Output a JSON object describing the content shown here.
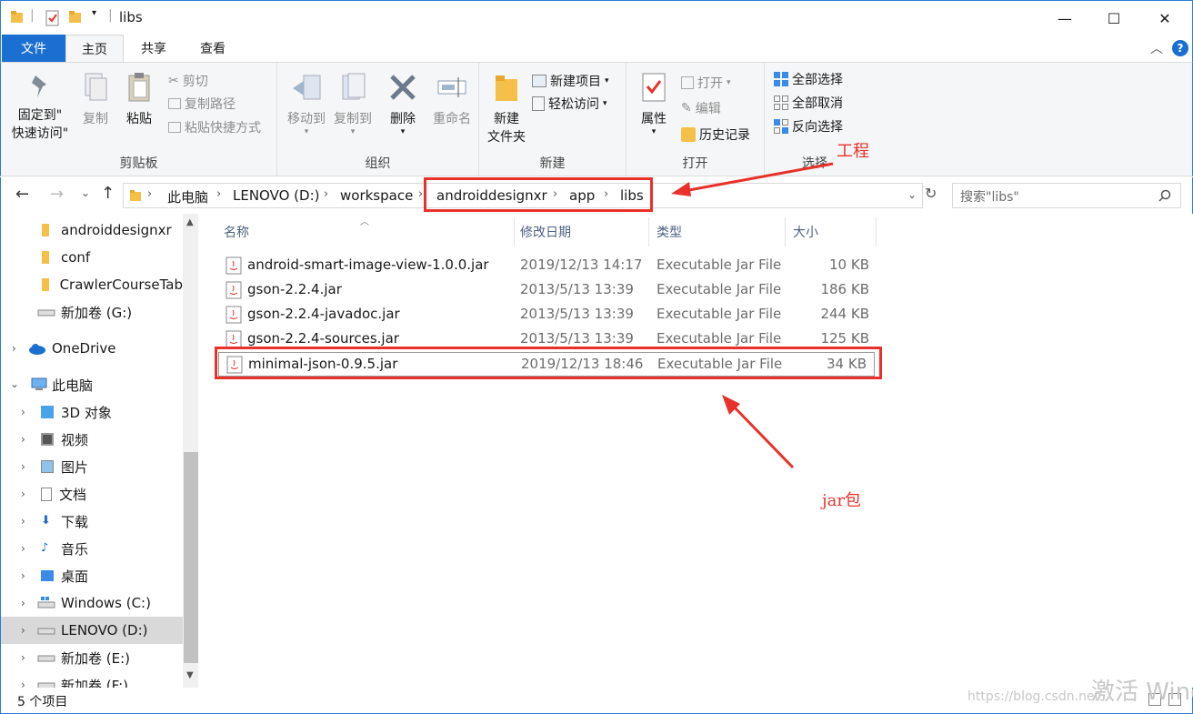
{
  "window": {
    "title": "libs",
    "minimize": "—",
    "maximize": "☐",
    "close": "✕"
  },
  "tabs": {
    "file": "文件",
    "home": "主页",
    "share": "共享",
    "view": "查看"
  },
  "ribbon": {
    "clipboard": {
      "label": "剪贴板",
      "pin": "固定到\"\n快速访问\"",
      "pin_line1": "固定到\"",
      "pin_line2": "快速访问\"",
      "copy": "复制",
      "paste": "粘贴",
      "cut": "剪切",
      "copy_path": "复制路径",
      "paste_shortcut": "粘贴快捷方式"
    },
    "organize": {
      "label": "组织",
      "move_to": "移动到",
      "copy_to": "复制到",
      "delete": "删除",
      "rename": "重命名"
    },
    "new": {
      "label": "新建",
      "new_folder_line1": "新建",
      "new_folder_line2": "文件夹",
      "new_item": "新建项目",
      "easy_access": "轻松访问"
    },
    "open": {
      "label": "打开",
      "properties": "属性",
      "open": "打开",
      "edit": "编辑",
      "history": "历史记录"
    },
    "select": {
      "label": "选择",
      "select_all": "全部选择",
      "select_none": "全部取消",
      "invert": "反向选择"
    }
  },
  "address": {
    "crumbs": [
      "此电脑",
      "LENOVO (D:)",
      "workspace",
      "androiddesignxr",
      "app",
      "libs"
    ],
    "search_placeholder": "搜索\"libs\""
  },
  "nav": {
    "items": [
      {
        "label": "androiddesignxr",
        "icon": "folder-icon"
      },
      {
        "label": "conf",
        "icon": "folder-icon"
      },
      {
        "label": "CrawlerCourseTab",
        "icon": "folder-icon"
      },
      {
        "label": "新加卷 (G:)",
        "icon": "drive-icon"
      },
      {
        "label": "OneDrive",
        "icon": "cloud-icon"
      },
      {
        "label": "此电脑",
        "icon": "computer-icon"
      },
      {
        "label": "3D 对象",
        "icon": "3d-objects-icon"
      },
      {
        "label": "视频",
        "icon": "video-icon"
      },
      {
        "label": "图片",
        "icon": "pictures-icon"
      },
      {
        "label": "文档",
        "icon": "documents-icon"
      },
      {
        "label": "下载",
        "icon": "downloads-icon"
      },
      {
        "label": "音乐",
        "icon": "music-icon"
      },
      {
        "label": "桌面",
        "icon": "desktop-icon"
      },
      {
        "label": "Windows (C:)",
        "icon": "windows-drive-icon"
      },
      {
        "label": "LENOVO (D:)",
        "icon": "drive-icon"
      },
      {
        "label": "新加卷 (E:)",
        "icon": "drive-icon"
      },
      {
        "label": "新加卷 (F:)",
        "icon": "drive-icon"
      }
    ]
  },
  "columns": {
    "name": "名称",
    "date": "修改日期",
    "type": "类型",
    "size": "大小"
  },
  "files": [
    {
      "name": "android-smart-image-view-1.0.0.jar",
      "date": "2019/12/13 14:17",
      "type": "Executable Jar File",
      "size": "10 KB"
    },
    {
      "name": "gson-2.2.4.jar",
      "date": "2013/5/13 13:39",
      "type": "Executable Jar File",
      "size": "186 KB"
    },
    {
      "name": "gson-2.2.4-javadoc.jar",
      "date": "2013/5/13 13:39",
      "type": "Executable Jar File",
      "size": "244 KB"
    },
    {
      "name": "gson-2.2.4-sources.jar",
      "date": "2013/5/13 13:39",
      "type": "Executable Jar File",
      "size": "125 KB"
    },
    {
      "name": "minimal-json-0.9.5.jar",
      "date": "2019/12/13 18:46",
      "type": "Executable Jar File",
      "size": "34 KB"
    }
  ],
  "status": {
    "count": "5 个项目",
    "watermark": "激活 Wind",
    "csdn": "https://blog.csdn.net"
  },
  "annotations": {
    "project": "工程",
    "jar": "jar包"
  },
  "colors": {
    "accent": "#1a6fd0",
    "annotation": "#e8312a",
    "folder": "#f5c04a"
  }
}
